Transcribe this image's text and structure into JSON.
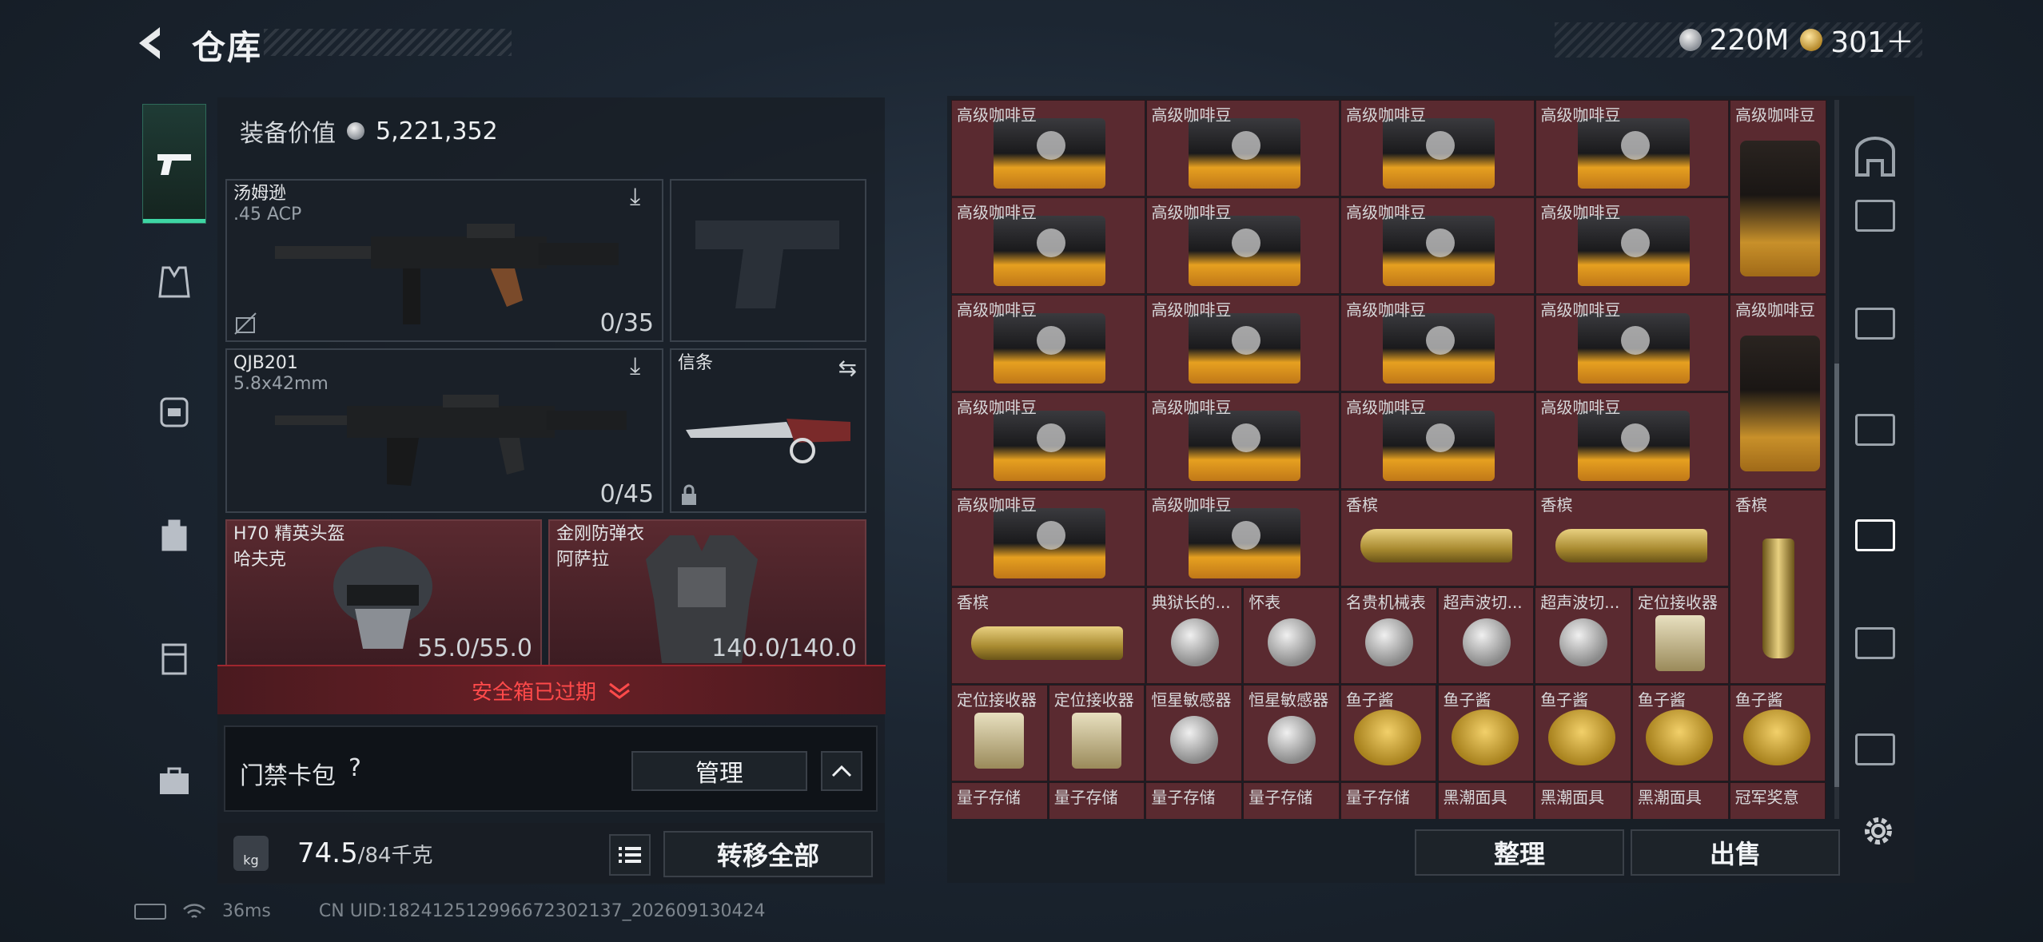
{
  "header": {
    "title": "仓库",
    "currency": [
      {
        "icon": "silver-coin-icon",
        "value": "220M"
      },
      {
        "icon": "gold-coin-icon",
        "value": "301＋"
      }
    ]
  },
  "left_rail": [
    "pistol-icon",
    "vest-icon",
    "backpack-icon",
    "bag-icon",
    "case-icon",
    "toolbox-icon"
  ],
  "equipment": {
    "value_label": "装备价值",
    "value": "5,221,352",
    "primary": {
      "name": "汤姆逊",
      "ammo": ".45 ACP",
      "count": "0/35"
    },
    "secondary": {
      "name": "QJB201",
      "ammo": "5.8x42mm",
      "count": "0/45"
    },
    "melee": {
      "name": "信条"
    },
    "helmet": {
      "name": "H70 精英头盔",
      "sub": "哈夫克",
      "durability": "55.0/55.0"
    },
    "armor": {
      "name": "金刚防弹衣",
      "sub": "阿萨拉",
      "durability": "140.0/140.0"
    }
  },
  "safe_box": {
    "expired_label": "安全箱已过期"
  },
  "keycard": {
    "label": "门禁卡包",
    "help": "?",
    "manage_label": "管理"
  },
  "weight": {
    "current": "74.5",
    "max": "/84千克",
    "icon": "kg"
  },
  "transfer_all_label": "转移全部",
  "status": {
    "ping": "36ms",
    "uid": "CN UID:182412512996672302137_202609130424"
  },
  "stash": {
    "items": {
      "coffee": "高级咖啡豆",
      "champagne": "香槟",
      "medal": "典狱长的...",
      "watch": "怀表",
      "luxury_watch": "名贵机械表",
      "ultrasonic": "超声波切...",
      "locator": "定位接收器",
      "sensor": "恒星敏感器",
      "caviar": "鱼子酱",
      "quantum": "量子存储",
      "mask": "黑潮面具",
      "trophy": "冠军奖意"
    },
    "sort_label": "整理",
    "sell_label": "出售"
  },
  "right_rail": [
    "safehouse-icon",
    "room-card-icon-1",
    "room-card-icon-5",
    "room-card-icon-5b",
    "room-card-gti-icon",
    "room-card-iv-icon",
    "room-card-iv2-icon"
  ]
}
